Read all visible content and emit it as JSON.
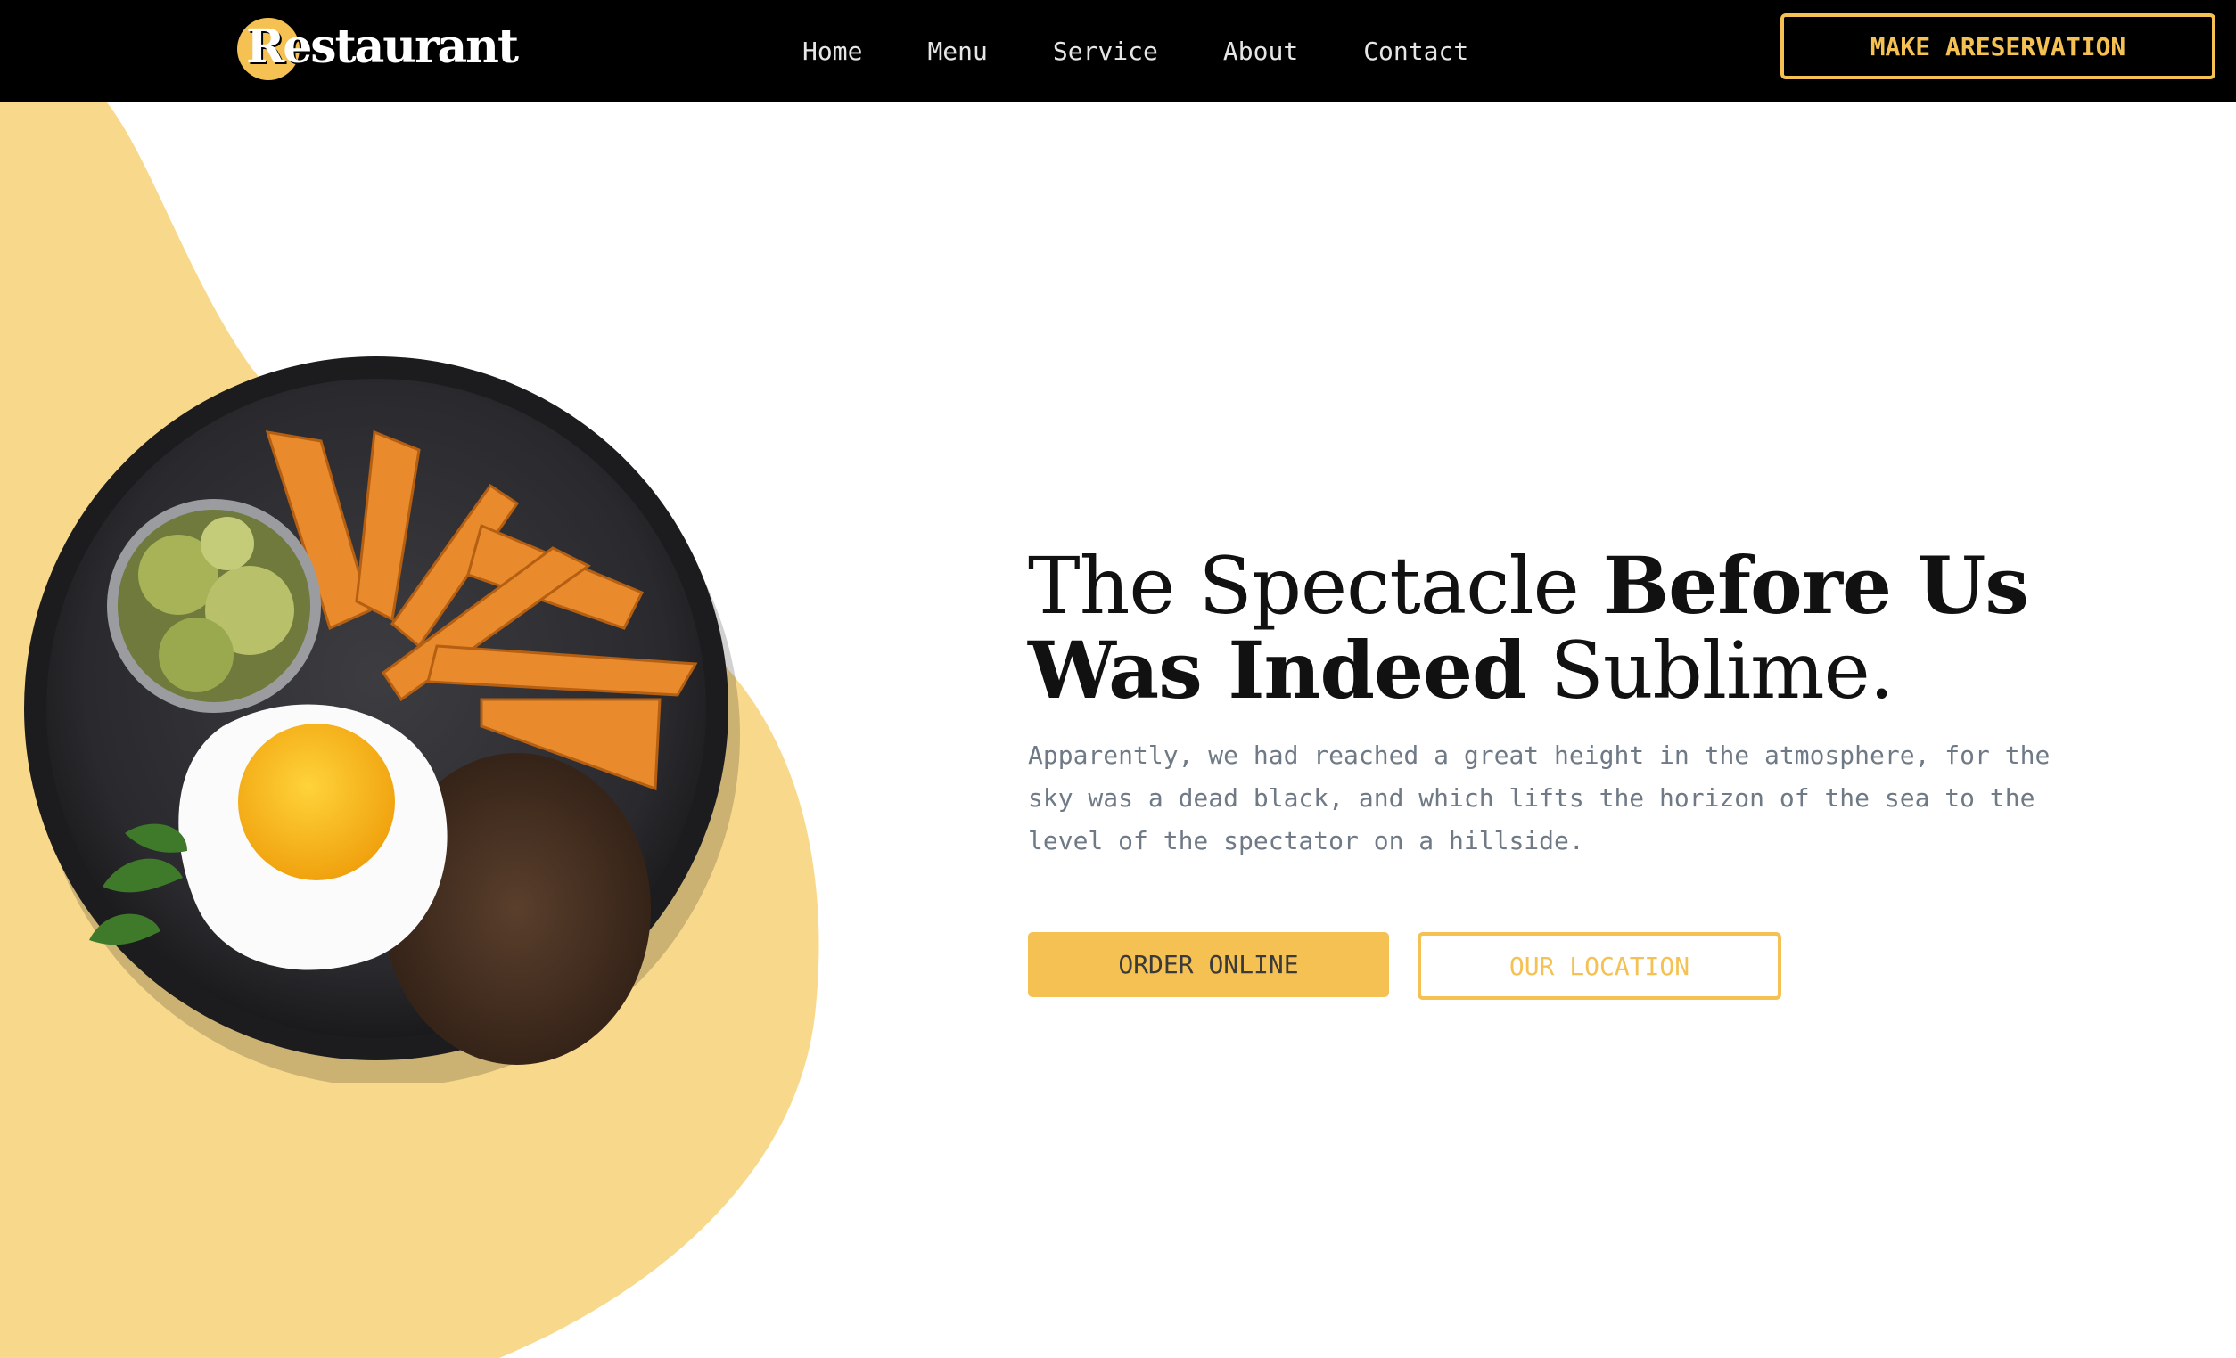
{
  "header": {
    "logo_text": "Restaurant",
    "nav": [
      {
        "label": "Home"
      },
      {
        "label": "Menu"
      },
      {
        "label": "Service"
      },
      {
        "label": "About"
      },
      {
        "label": "Contact"
      }
    ],
    "reserve_label": "MAKE ARESERVATION"
  },
  "hero": {
    "headline_line1_light": "The Spectacle ",
    "headline_line1_bold": "Before Us",
    "headline_line2_bold": "Was Indeed",
    "headline_line2_light": " Sublime.",
    "description": "Apparently, we had reached a great height in the atmosphere, for the sky was a dead black, and which lifts the horizon of the sea to the level of the spectator on a hillside.",
    "order_label": "ORDER ONLINE",
    "location_label": "OUR LOCATION"
  },
  "colors": {
    "accent": "#f4c152",
    "blob": "#f8d98c",
    "header_bg": "#000000",
    "text_dark": "#111111",
    "text_muted": "#6f7a86"
  },
  "icons": {
    "hero_image": "plate-with-egg-patty-fries-pickles"
  }
}
